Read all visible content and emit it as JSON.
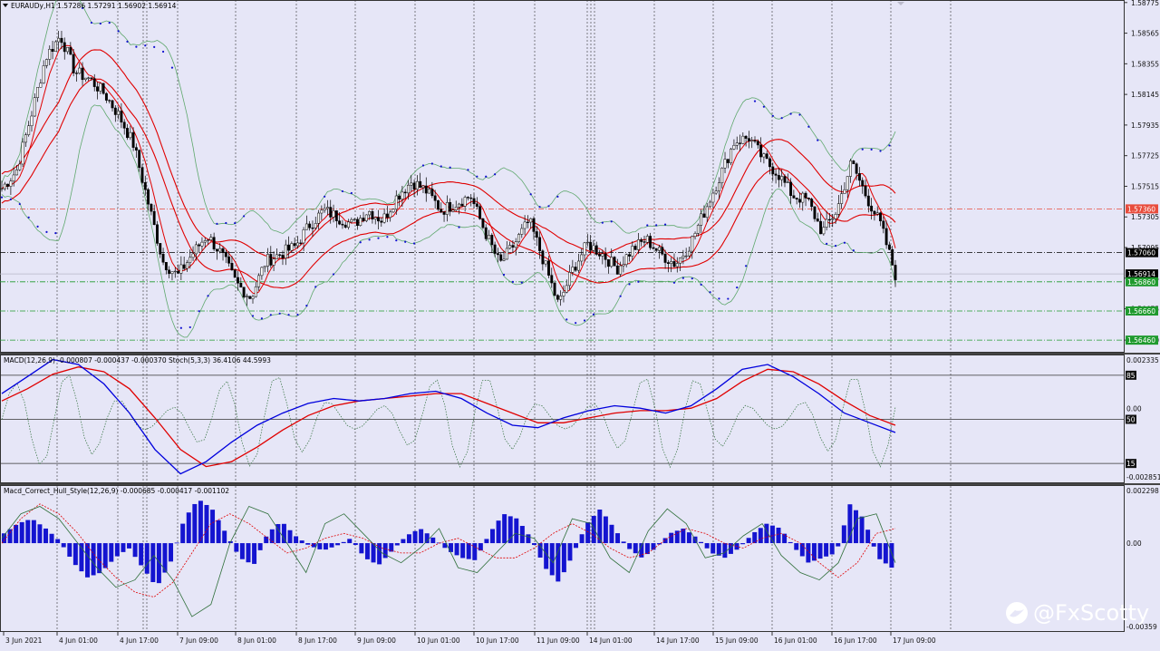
{
  "header": {
    "symbol_line": "EURAUDy,H1  1.57286 1.57291 1.56902 1.56914",
    "macd_line": "MACD(12,26,9) -0.000807 -0.000437 -0.000370  Stoch(5,3,3) 36.4106 44.5993",
    "hull_line": "Macd_Correct_Hull_Style(12,26,9) -0.000685 -0.000417 -0.001102"
  },
  "watermark": "@FxScotty",
  "colors": {
    "background": "#e6e6f7",
    "grid": "#333333",
    "bollinger": "#5fa86d",
    "envelope": "#e00000",
    "sar": "#1010d0",
    "macd_main": "#0000dd",
    "macd_signal": "#e00000",
    "stoch": "#2f6f3a",
    "histogram": "#1414d0",
    "level_red": "#e84c3c",
    "level_green": "#1f9a2e",
    "price_tag": "#000000"
  },
  "chart_data": [
    {
      "type": "candlestick",
      "name": "EURAUDy,H1",
      "price_axis": {
        "min": 1.5638,
        "max": 1.5878,
        "ticks": [
          "1.58775",
          "1.58565",
          "1.58355",
          "1.58145",
          "1.57935",
          "1.57725",
          "1.57515",
          "1.57305",
          "1.57095",
          "1.56885",
          "1.56675",
          "1.56460"
        ]
      },
      "time_labels": [
        "3 Jun 2021",
        "4 Jun 01:00",
        "4 Jun 17:00",
        "7 Jun 09:00",
        "8 Jun 01:00",
        "8 Jun 17:00",
        "9 Jun 09:00",
        "10 Jun 01:00",
        "10 Jun 17:00",
        "11 Jun 09:00",
        "14 Jun 01:00",
        "14 Jun 17:00",
        "15 Jun 09:00",
        "16 Jun 01:00",
        "16 Jun 17:00",
        "17 Jun 09:00"
      ],
      "close_path": [
        1.575,
        1.5762,
        1.58,
        1.584,
        1.5855,
        1.583,
        1.5825,
        1.5815,
        1.58,
        1.578,
        1.574,
        1.57,
        1.569,
        1.5705,
        1.5718,
        1.5705,
        1.5685,
        1.5675,
        1.57,
        1.5705,
        1.571,
        1.5725,
        1.5735,
        1.573,
        1.5725,
        1.5735,
        1.5728,
        1.5745,
        1.5755,
        1.5748,
        1.5735,
        1.574,
        1.5745,
        1.572,
        1.5698,
        1.5712,
        1.5728,
        1.57,
        1.567,
        1.5695,
        1.5712,
        1.5705,
        1.5695,
        1.5708,
        1.5715,
        1.5705,
        1.5698,
        1.5712,
        1.5735,
        1.5758,
        1.5782,
        1.5785,
        1.577,
        1.576,
        1.5745,
        1.5742,
        1.572,
        1.5735,
        1.5768,
        1.5745,
        1.5725,
        1.5691
      ],
      "sar_count": 90,
      "levels": [
        {
          "price": "1.57360",
          "color": "red",
          "style": "dash-dot"
        },
        {
          "price": "1.57060",
          "color": "black",
          "style": "dash-dot"
        },
        {
          "price": "1.56914",
          "color": "black",
          "style": "current"
        },
        {
          "price": "1.56860",
          "color": "green",
          "style": "dash-dot"
        },
        {
          "price": "1.56660",
          "color": "green",
          "style": "dash-dot"
        },
        {
          "price": "1.56460",
          "color": "green",
          "style": "dash-dot"
        }
      ]
    },
    {
      "type": "line",
      "name": "MACD(12,26,9) / Stoch(5,3,3)",
      "axis": {
        "top": "0.002335",
        "bottom": "-0.002851",
        "zero": "0.00",
        "level_top": "85",
        "level_mid": "50",
        "level_bottom": "15"
      },
      "macd": [
        0.0008,
        0.0015,
        0.0022,
        0.002,
        0.0012,
        0.0,
        -0.0015,
        -0.0025,
        -0.002,
        -0.0012,
        -0.0005,
        0.0,
        0.0004,
        0.0006,
        0.0005,
        0.0006,
        0.0008,
        0.0009,
        0.0006,
        0.0,
        -0.0005,
        -0.0006,
        -0.0002,
        0.0001,
        0.0003,
        0.0002,
        0.0,
        0.0003,
        0.001,
        0.0018,
        0.002,
        0.0015,
        0.0008,
        0.0,
        -0.0004,
        -0.0008
      ],
      "signal": [
        0.0005,
        0.001,
        0.0016,
        0.0019,
        0.0017,
        0.001,
        -0.0002,
        -0.0015,
        -0.0022,
        -0.002,
        -0.0014,
        -0.0007,
        -0.0001,
        0.0003,
        0.0005,
        0.0006,
        0.0007,
        0.0008,
        0.0008,
        0.0004,
        0.0,
        -0.0004,
        -0.0004,
        -0.0002,
        0.0,
        0.0001,
        0.0001,
        0.0002,
        0.0006,
        0.0013,
        0.0018,
        0.0017,
        0.0012,
        0.0005,
        -0.0001,
        -0.0005
      ],
      "stoch_count": 120
    },
    {
      "type": "bar",
      "name": "Macd_Correct_Hull_Style(12,26,9)",
      "axis": {
        "top": "0.002298",
        "zero": "0.00",
        "bottom": "-0.00359"
      },
      "histogram": [
        0.0004,
        0.0008,
        0.001,
        0.0006,
        0.0001,
        -0.0008,
        -0.0014,
        -0.0012,
        -0.0006,
        -0.0002,
        -0.001,
        -0.0018,
        -0.0008,
        0.001,
        0.0018,
        0.0014,
        0.0004,
        -0.0006,
        -0.0009,
        0.0004,
        0.0009,
        0.0003,
        -0.0001,
        -0.0003,
        -0.0001,
        0.0002,
        -0.0006,
        -0.0009,
        -0.0003,
        0.0003,
        0.0006,
        0.0002,
        -0.0003,
        -0.0006,
        -0.0007,
        0.0004,
        0.0012,
        0.001,
        0.0002,
        -0.001,
        -0.0016,
        -0.0005,
        0.0008,
        0.0014,
        0.0006,
        -0.0002,
        -0.0006,
        -0.0002,
        0.0004,
        0.0006,
        0.0002,
        -0.0004,
        -0.0006,
        -0.0002,
        0.0004,
        0.0008,
        0.0006,
        -0.0002,
        -0.0008,
        -0.0006,
        -0.0004,
        0.0016,
        0.001,
        -0.0006,
        -0.001
      ],
      "fast": [
        0.0002,
        0.0012,
        0.0015,
        0.001,
        0.0,
        -0.001,
        -0.0018,
        -0.0015,
        -0.0005,
        -0.0015,
        -0.003,
        -0.0025,
        0.0,
        0.0015,
        0.0012,
        0.0,
        -0.0012,
        0.0008,
        0.0012,
        0.0004,
        -0.0004,
        -0.0008,
        -0.0002,
        0.0006,
        -0.001,
        -0.0012,
        -0.0004,
        0.0004,
        0.0002,
        -0.0008,
        0.001,
        0.0008,
        -0.0006,
        -0.0012,
        0.0005,
        0.0014,
        0.0008,
        -0.0006,
        -0.0004,
        0.0003,
        0.0008,
        -0.0005,
        -0.0012,
        -0.0015,
        -0.0008,
        0.001,
        0.0012,
        -0.0008
      ],
      "slow": [
        0.0,
        0.001,
        0.0016,
        0.0012,
        0.0004,
        -0.0006,
        -0.0014,
        -0.002,
        -0.0022,
        -0.0016,
        -0.0004,
        0.0008,
        0.0012,
        0.0008,
        0.0002,
        -0.0004,
        -0.0002,
        0.0002,
        0.0004,
        0.0002,
        -0.0002,
        -0.0004,
        -0.0004,
        0.0,
        0.0002,
        -0.0002,
        -0.0006,
        -0.0006,
        -0.0002,
        0.0004,
        0.0008,
        0.0004,
        -0.0002,
        -0.0006,
        -0.0004,
        0.0002,
        0.0006,
        0.0004,
        0.0,
        -0.0002,
        0.0002,
        0.0004,
        0.0,
        -0.0008,
        -0.0014,
        -0.0008,
        0.0004,
        0.0006
      ]
    }
  ]
}
